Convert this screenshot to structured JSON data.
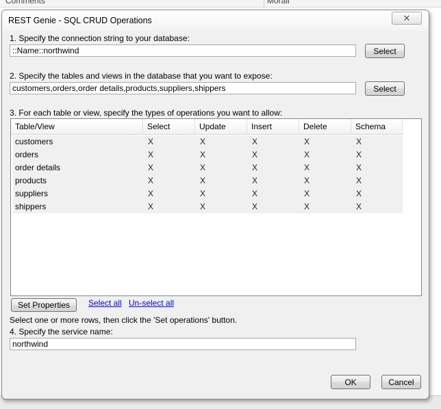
{
  "background": {
    "top_text_left": "Comments",
    "top_text_right": "Morall"
  },
  "dialog": {
    "title": "REST Genie - SQL CRUD Operations",
    "close_glyph": "✕"
  },
  "step1": {
    "label": "1. Specify the connection string to your database:",
    "value": "::Name::northwind",
    "button": "Select"
  },
  "step2": {
    "label": "2. Specify the tables and views in the database that you want to expose:",
    "value": "customers,orders,order details,products,suppliers,shippers",
    "button": "Select"
  },
  "step3": {
    "label": "3. For each table or view, specify the types of operations you want to allow:",
    "columns": [
      "Table/View",
      "Select",
      "Update",
      "Insert",
      "Delete",
      "Schema"
    ],
    "rows": [
      {
        "name": "customers",
        "ops": [
          "X",
          "X",
          "X",
          "X",
          "X"
        ]
      },
      {
        "name": "orders",
        "ops": [
          "X",
          "X",
          "X",
          "X",
          "X"
        ]
      },
      {
        "name": "order details",
        "ops": [
          "X",
          "X",
          "X",
          "X",
          "X"
        ]
      },
      {
        "name": "products",
        "ops": [
          "X",
          "X",
          "X",
          "X",
          "X"
        ]
      },
      {
        "name": "suppliers",
        "ops": [
          "X",
          "X",
          "X",
          "X",
          "X"
        ]
      },
      {
        "name": "shippers",
        "ops": [
          "X",
          "X",
          "X",
          "X",
          "X"
        ]
      }
    ],
    "set_properties_button": "Set Properties",
    "select_all_link": "Select all",
    "unselect_all_link": "Un-select all",
    "hint": "Select one or more rows, then click the 'Set operations' button."
  },
  "step4": {
    "label": "4. Specify the service name:",
    "value": "northwind"
  },
  "footer": {
    "ok_button": "OK",
    "cancel_button": "Cancel"
  }
}
